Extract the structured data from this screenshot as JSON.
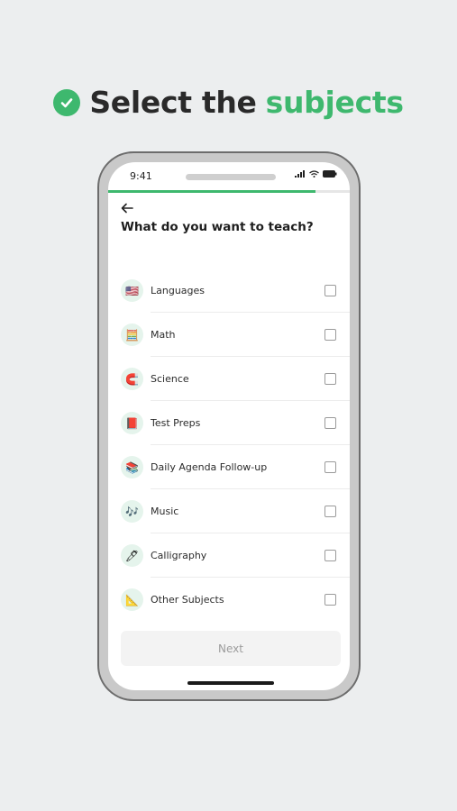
{
  "headline": {
    "prefix": "Select the",
    "accent": "subjects",
    "accent_color": "#3eb86e",
    "check_icon": "check-circle-icon"
  },
  "status_bar": {
    "time": "9:41",
    "icons": [
      "signal-icon",
      "wifi-icon",
      "battery-icon"
    ]
  },
  "progress": {
    "fraction": 0.86
  },
  "question": "What do you want to teach?",
  "subjects": [
    {
      "label": "Languages",
      "icon": "flag-icon",
      "glyph": "🇺🇸",
      "checked": false
    },
    {
      "label": "Math",
      "icon": "abacus-icon",
      "glyph": "🧮",
      "checked": false
    },
    {
      "label": "Science",
      "icon": "magnet-icon",
      "glyph": "🧲",
      "checked": false
    },
    {
      "label": "Test Preps",
      "icon": "book-icon",
      "glyph": "📕",
      "checked": false
    },
    {
      "label": "Daily Agenda Follow-up",
      "icon": "books-icon",
      "glyph": "📚",
      "checked": false
    },
    {
      "label": "Music",
      "icon": "music-notes-icon",
      "glyph": "🎶",
      "checked": false
    },
    {
      "label": "Calligraphy",
      "icon": "pen-icon",
      "glyph": "🖊",
      "checked": false
    },
    {
      "label": "Other Subjects",
      "icon": "ruler-icon",
      "glyph": "📐",
      "checked": false
    }
  ],
  "next_button": {
    "label": "Next",
    "enabled": false
  }
}
